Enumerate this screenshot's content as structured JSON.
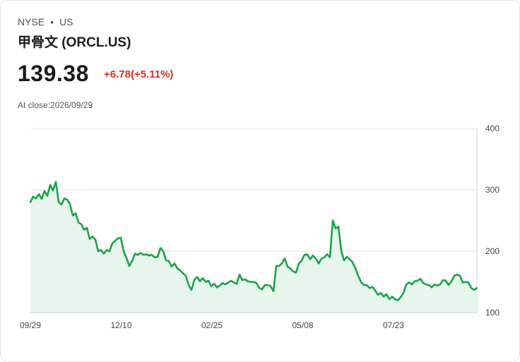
{
  "header": {
    "exchange": "NYSE",
    "separator": "•",
    "region": "US",
    "title": "甲骨文 (ORCL.US)",
    "price": "139.38",
    "change": "+6.78(+5.11%)",
    "close_label": "At close:2026/09/29"
  },
  "colors": {
    "line": "#1aa34a",
    "fill": "#e8f5ec",
    "change": "#d93025",
    "grid": "#e3e3e3"
  },
  "chart_data": {
    "type": "area",
    "title": "",
    "xlabel": "",
    "ylabel": "",
    "ylim": [
      100,
      400
    ],
    "y_ticks": [
      400,
      300,
      200,
      100
    ],
    "x_ticks": [
      "09/29",
      "12/10",
      "02/25",
      "05/08",
      "07/23"
    ],
    "grid": true,
    "series": [
      {
        "values": [
          280,
          289,
          286,
          293,
          285,
          298,
          290,
          308,
          299,
          313,
          280,
          276,
          286,
          284,
          277,
          258,
          262,
          247,
          244,
          235,
          238,
          220,
          224,
          219,
          200,
          202,
          196,
          202,
          200,
          213,
          217,
          221,
          222,
          200,
          189,
          176,
          184,
          196,
          194,
          197,
          194,
          195,
          193,
          194,
          190,
          191,
          205,
          200,
          185,
          184,
          175,
          180,
          172,
          169,
          164,
          160,
          145,
          137,
          153,
          158,
          151,
          156,
          150,
          152,
          143,
          147,
          141,
          144,
          148,
          146,
          149,
          152,
          149,
          147,
          162,
          153,
          154,
          151,
          150,
          150,
          148,
          140,
          138,
          145,
          145,
          143,
          135,
          176,
          176,
          180,
          188,
          175,
          172,
          167,
          165,
          180,
          185,
          194,
          195,
          187,
          193,
          188,
          180,
          188,
          190,
          195,
          190,
          250,
          237,
          240,
          201,
          185,
          191,
          187,
          182,
          172,
          160,
          150,
          145,
          145,
          140,
          142,
          136,
          129,
          132,
          126,
          130,
          122,
          126,
          122,
          120,
          125,
          132,
          146,
          149,
          146,
          151,
          152,
          155,
          148,
          146,
          145,
          141,
          146,
          144,
          146,
          153,
          152,
          145,
          151,
          160,
          162,
          160,
          149,
          150,
          149,
          140,
          137,
          140
        ]
      }
    ]
  }
}
